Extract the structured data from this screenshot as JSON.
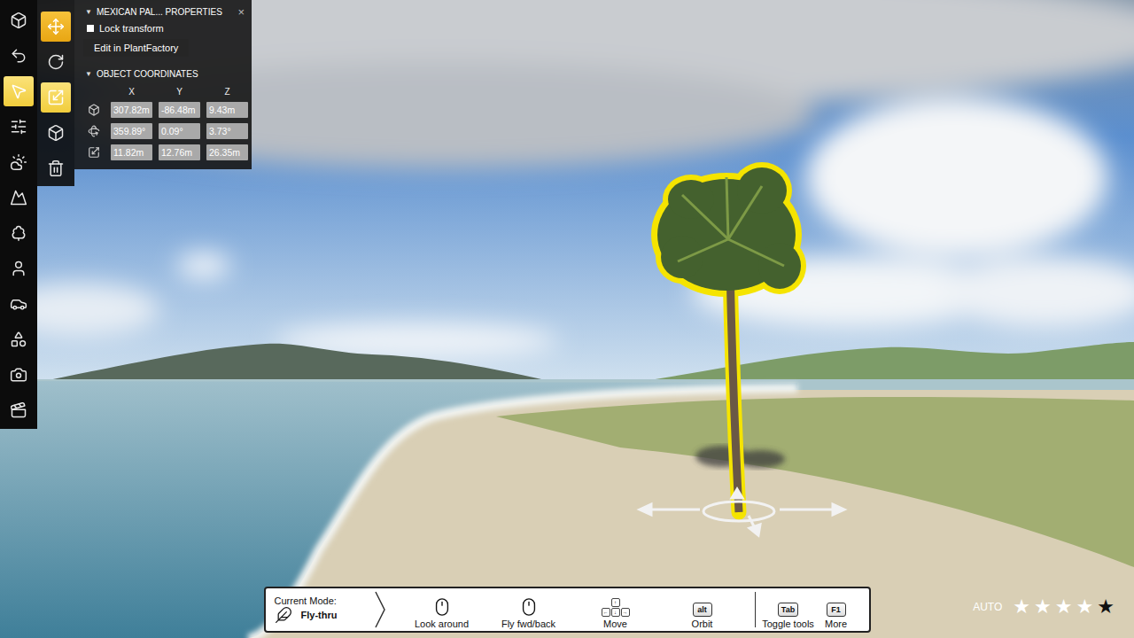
{
  "main_toolbar": [
    {
      "selected": false
    },
    {
      "selected": false
    },
    {
      "selected": true
    },
    {
      "selected": false
    },
    {
      "selected": false
    },
    {
      "selected": false
    },
    {
      "selected": false
    },
    {
      "selected": false
    },
    {
      "selected": false
    },
    {
      "selected": false
    },
    {
      "selected": false
    },
    {
      "selected": false
    }
  ],
  "sub_toolbar": [
    {
      "selected": true
    },
    {
      "selected": false
    },
    {
      "selected": true
    },
    {
      "selected": false
    },
    {
      "selected": false
    }
  ],
  "properties": {
    "title": "MEXICAN PAL... PROPERTIES",
    "close": "×",
    "expanded": true,
    "expand_glyph": "▼",
    "lock_transform": {
      "label": "Lock transform",
      "checked": false
    },
    "edit_button": "Edit in PlantFactory",
    "coordinates": {
      "title": "OBJECT COORDINATES",
      "expanded": true,
      "columns": [
        "X",
        "Y",
        "Z"
      ],
      "rows": [
        {
          "values": [
            "307.82m",
            "-86.48m",
            "9.43m"
          ]
        },
        {
          "values": [
            "359.89°",
            "0.09°",
            "3.73°"
          ]
        },
        {
          "values": [
            "11.82m",
            "12.76m",
            "26.35m"
          ]
        }
      ]
    }
  },
  "mode_bar": {
    "label": "Current Mode:",
    "mode": "Fly-thru",
    "actions": [
      {
        "kind": "mouse",
        "label": "Look around"
      },
      {
        "kind": "mouse",
        "label": "Fly fwd/back"
      },
      {
        "kind": "arrows",
        "label": "Move",
        "keys": [
          "↑",
          "←",
          "↓",
          "→"
        ]
      },
      {
        "kind": "key",
        "label": "Orbit",
        "key": "alt"
      }
    ],
    "extras": [
      {
        "key": "Tab",
        "label": "Toggle tools"
      },
      {
        "key": "F1",
        "label": "More"
      }
    ]
  },
  "quality": {
    "label": "AUTO",
    "glyph": "★",
    "max": 5,
    "stars": 4
  }
}
